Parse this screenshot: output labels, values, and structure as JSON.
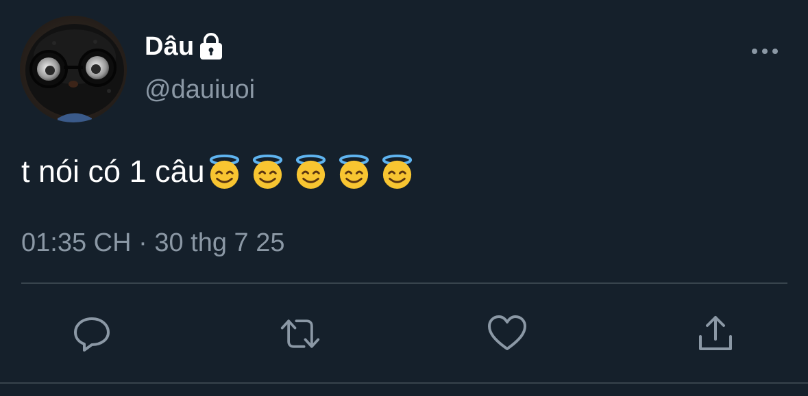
{
  "tweet": {
    "author": {
      "display_name": "Dâu",
      "handle": "@dauiuoi",
      "avatar_icon": "plush-toy-with-glasses-avatar",
      "protected_icon": "lock-icon"
    },
    "text": "t nói có 1 câu",
    "emojis": [
      "smiling-face-with-halo",
      "smiling-face-with-halo",
      "smiling-face-with-halo",
      "smiling-face-with-halo",
      "smiling-face-with-halo"
    ],
    "time": "01:35 CH",
    "separator": "·",
    "date": "30 thg 7 25"
  },
  "actions": {
    "reply_icon": "reply-icon",
    "retweet_icon": "retweet-icon",
    "like_icon": "heart-icon",
    "share_icon": "share-icon",
    "more_icon": "more-options-icon"
  },
  "colors": {
    "background": "#15202b",
    "text_primary": "#ffffff",
    "text_secondary": "#8b98a5",
    "divider": "#38444d",
    "icon": "#8b98a5"
  }
}
